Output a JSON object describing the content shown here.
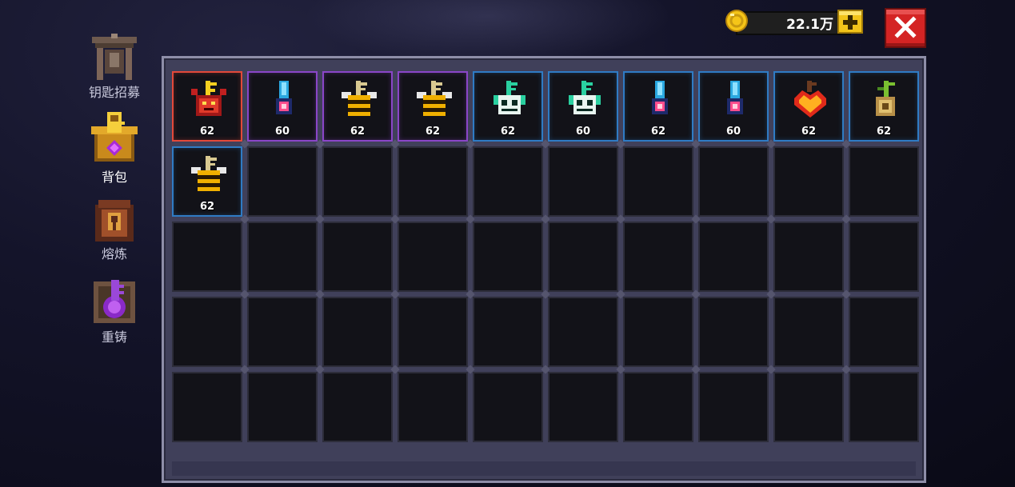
{
  "currency": {
    "amount": "22.1万",
    "coin_icon": "gold-coin-icon",
    "add_icon": "plus-icon",
    "color": "#f5c518"
  },
  "close": {
    "icon": "close-x-icon",
    "color": "#d42424"
  },
  "sidebar": {
    "items": [
      {
        "label": "钥匙招募",
        "icon": "recruit-shrine-icon",
        "active": false
      },
      {
        "label": "背包",
        "icon": "golden-key-chest-icon",
        "active": true
      },
      {
        "label": "熔炼",
        "icon": "furnace-key-icon",
        "active": false
      },
      {
        "label": "重铸",
        "icon": "recast-purple-key-icon",
        "active": false
      }
    ]
  },
  "inventory": {
    "columns": 10,
    "rows": 5,
    "items": [
      {
        "name": "demon-key",
        "level": "62",
        "rarity": "red"
      },
      {
        "name": "cyan-crystal-key",
        "level": "60",
        "rarity": "purple"
      },
      {
        "name": "bee-key",
        "level": "62",
        "rarity": "purple"
      },
      {
        "name": "bee-key",
        "level": "62",
        "rarity": "purple"
      },
      {
        "name": "skull-key",
        "level": "62",
        "rarity": "blue"
      },
      {
        "name": "skull-key",
        "level": "60",
        "rarity": "blue"
      },
      {
        "name": "cyan-crystal-key",
        "level": "62",
        "rarity": "blue"
      },
      {
        "name": "cyan-crystal-key",
        "level": "60",
        "rarity": "blue"
      },
      {
        "name": "heart-key",
        "level": "62",
        "rarity": "blue"
      },
      {
        "name": "vine-key",
        "level": "62",
        "rarity": "blue"
      },
      {
        "name": "bee-key",
        "level": "62",
        "rarity": "blue"
      }
    ]
  }
}
